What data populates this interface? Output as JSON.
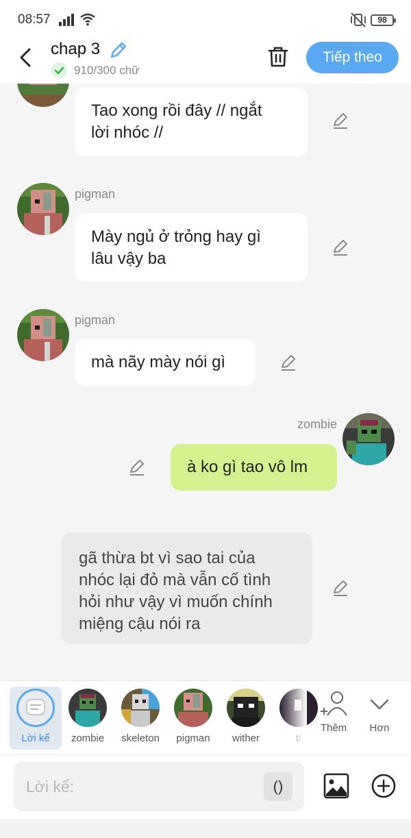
{
  "status_bar": {
    "time": "08:57",
    "battery": "98",
    "icons": [
      "signal-icon",
      "wifi-icon",
      "mute-vibrate-icon",
      "battery-icon"
    ]
  },
  "header": {
    "title": "chap 3",
    "word_count": "910/300 chữ",
    "next_label": "Tiếp theo",
    "accent": "#5aa8f0"
  },
  "messages": [
    {
      "type": "left",
      "sender": "",
      "avatar": "pigman",
      "text_lines": [
        "Tao xong rồi đây // ngắt",
        "lời nhóc //"
      ]
    },
    {
      "type": "left",
      "sender": "pigman",
      "avatar": "pigman",
      "text_lines": [
        "Mày ngủ ở trỏng hay gì",
        "lâu vậy ba"
      ]
    },
    {
      "type": "left",
      "sender": "pigman",
      "avatar": "pigman",
      "text_lines": [
        "mà nãy mày nói gì"
      ]
    },
    {
      "type": "right",
      "sender": "zombie",
      "avatar": "zombie",
      "text_lines": [
        "à ko gì tao vô lm"
      ]
    },
    {
      "type": "narration",
      "sender": "",
      "avatar": "",
      "text_lines": [
        "gã thừa bt vì sao tai của",
        "nhóc lại đỏ mà vẫn cố tình",
        "hỏi như vậy vì muốn chính",
        "miệng cậu nói ra"
      ]
    }
  ],
  "characters": [
    {
      "label": "Lời kể",
      "selected": true,
      "icon": "narration-icon"
    },
    {
      "label": "zombie",
      "selected": false,
      "icon": "zombie-avatar"
    },
    {
      "label": "skeleton",
      "selected": false,
      "icon": "skeleton-avatar"
    },
    {
      "label": "pigman",
      "selected": false,
      "icon": "pigman-avatar"
    },
    {
      "label": "wither",
      "selected": false,
      "icon": "wither-avatar"
    },
    {
      "label": "t/",
      "selected": false,
      "icon": "partial-avatar"
    }
  ],
  "char_tools": {
    "add_label": "Thêm",
    "more_label": "Hơn"
  },
  "input": {
    "placeholder": "Lời kể:",
    "paren": "()"
  },
  "colors": {
    "bubble_green": "#d5f291",
    "bubble_white": "#ffffff",
    "bubble_gray": "#eaeaea",
    "background": "#f5f5f5"
  }
}
